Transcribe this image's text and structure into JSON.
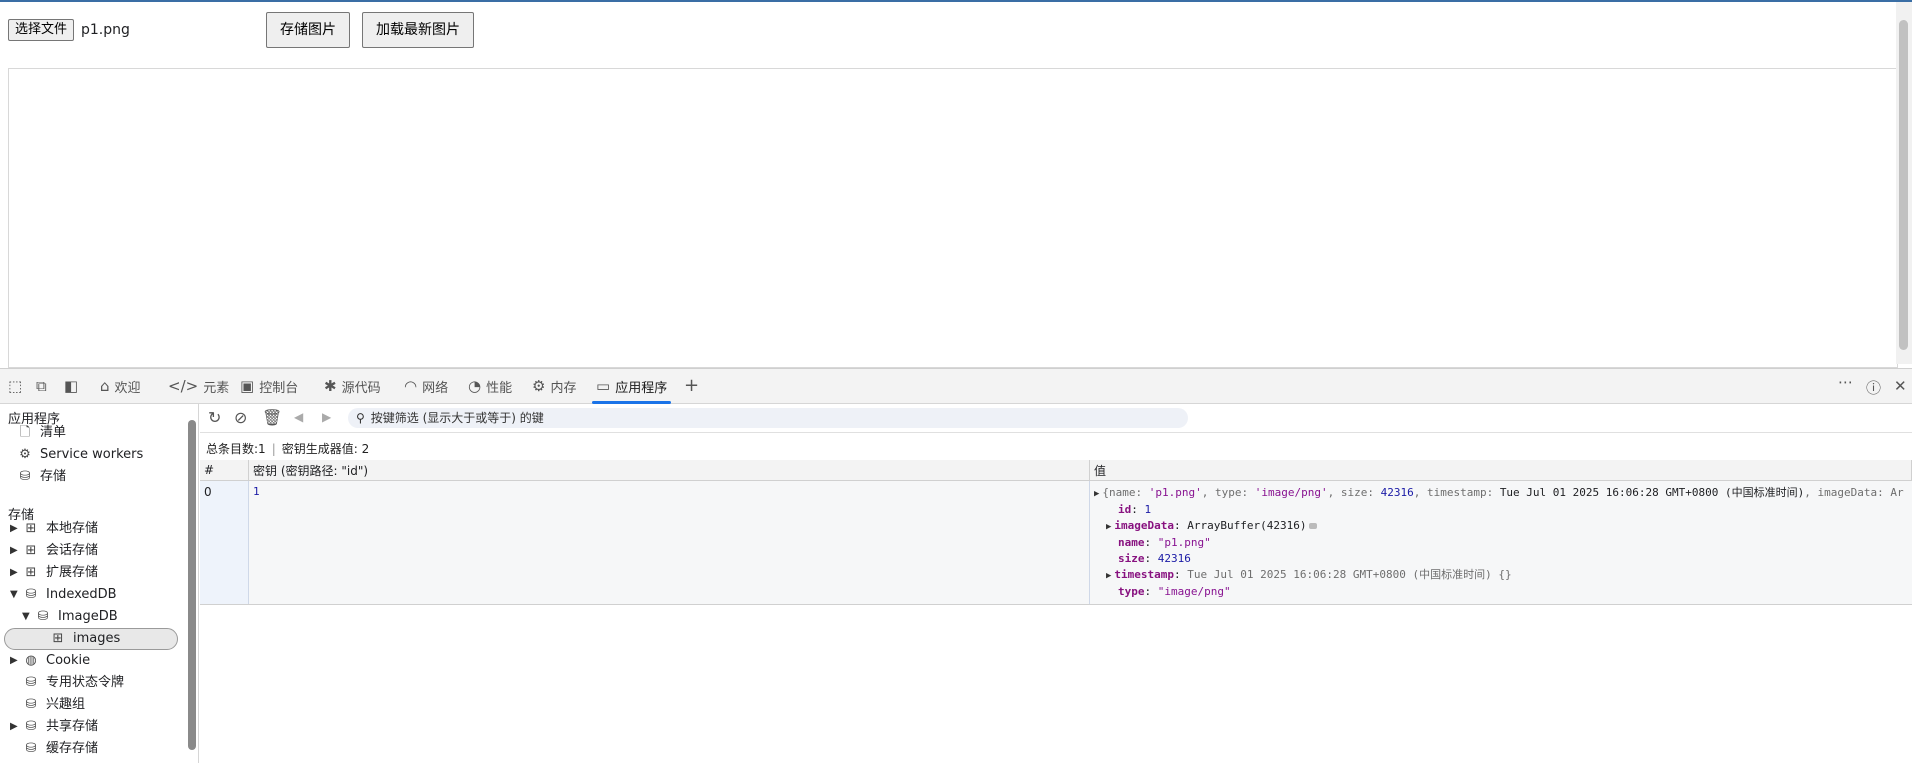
{
  "page": {
    "file_button_label": "选择文件",
    "file_name": "p1.png",
    "save_button_label": "存储图片",
    "load_button_label": "加载最新图片"
  },
  "devtools": {
    "tabs": [
      {
        "label": "欢迎",
        "icon": "home-icon"
      },
      {
        "label": "元素",
        "icon": "code-icon"
      },
      {
        "label": "控制台",
        "icon": "console-icon"
      },
      {
        "label": "源代码",
        "icon": "bug-icon"
      },
      {
        "label": "网络",
        "icon": "wifi-icon"
      },
      {
        "label": "性能",
        "icon": "gauge-icon"
      },
      {
        "label": "内存",
        "icon": "gear-icon"
      },
      {
        "label": "应用程序",
        "icon": "app-icon"
      }
    ],
    "sidebar": {
      "app_heading": "应用程序",
      "manifest": "清单",
      "service_workers": "Service workers",
      "storage_item": "存储",
      "storage_heading": "存储",
      "local_storage": "本地存储",
      "session_storage": "会话存储",
      "extension_storage": "扩展存储",
      "indexeddb": "IndexedDB",
      "imagedb": "ImageDB",
      "images": "images",
      "cookie": "Cookie",
      "private_state_tokens": "专用状态令牌",
      "interest_groups": "兴趣组",
      "shared_storage": "共享存储",
      "cache_storage": "缓存存储"
    },
    "main": {
      "filter_placeholder": "按键筛选 (显示大于或等于) 的键",
      "total_entries": "总条目数:1",
      "key_generator": "密钥生成器值: 2",
      "columns": {
        "index": "#",
        "key": "密钥 (密钥路径: \"id\")",
        "value": "值"
      },
      "row": {
        "index": "0",
        "key": "1",
        "preview_open": "{name: ",
        "preview_name_val": "'p1.png'",
        "preview_type_key": ", type: ",
        "preview_type_val": "'image/png'",
        "preview_size_key": ", size: ",
        "preview_size_val": "42316",
        "preview_ts_key": ", timestamp: ",
        "preview_ts_val": "Tue Jul 01 2025 16:06:28 GMT+0800 (中国标准时间)",
        "preview_tail": ", imageData: Ar",
        "id_key": "id",
        "id_val": "1",
        "imagedata_key": "imageData",
        "imagedata_val": "ArrayBuffer(42316)",
        "name_key": "name",
        "name_val": "\"p1.png\"",
        "size_key": "size",
        "size_val": "42316",
        "timestamp_key": "timestamp",
        "timestamp_val": "Tue Jul 01 2025 16:06:28 GMT+0800 (中国标准时间) {}",
        "type_key": "type",
        "type_val": "\"image/png\""
      }
    }
  }
}
